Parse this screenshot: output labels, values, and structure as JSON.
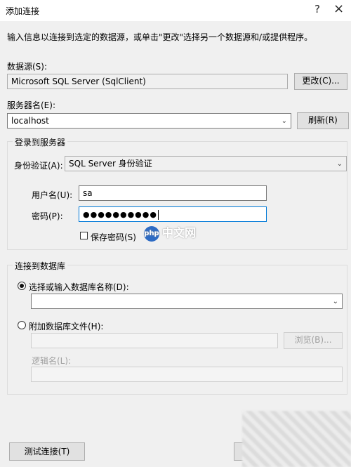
{
  "window": {
    "title": "添加连接",
    "help": "?",
    "close": "×"
  },
  "intro": "输入信息以连接到选定的数据源，或单击\"更改\"选择另一个数据源和/或提供程序。",
  "datasource": {
    "label": "数据源(S):",
    "value": "Microsoft SQL Server (SqlClient)",
    "change_button": "更改(C)..."
  },
  "server": {
    "label": "服务器名(E):",
    "value": "localhost",
    "refresh_button": "刷新(R)"
  },
  "login": {
    "group_title": "登录到服务器",
    "auth_label": "身份验证(A):",
    "auth_value": "SQL Server 身份验证",
    "username_label": "用户名(U):",
    "username_value": "sa",
    "password_label": "密码(P):",
    "password_value": "●●●●●●●●●●",
    "save_password": "保存密码(S)"
  },
  "database": {
    "group_title": "连接到数据库",
    "select_radio": "选择或输入数据库名称(D):",
    "select_value": "",
    "attach_radio": "附加数据库文件(H):",
    "attach_value": "",
    "browse_button": "浏览(B)...",
    "logical_label": "逻辑名(L):",
    "logical_value": ""
  },
  "footer": {
    "test_button": "测试连接(T)"
  },
  "watermark": {
    "logo": "php",
    "text": "中文网"
  }
}
